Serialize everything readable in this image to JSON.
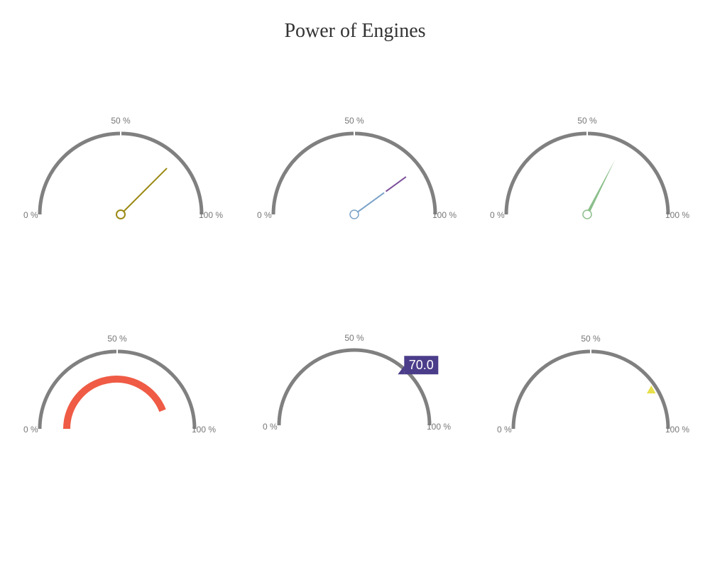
{
  "chart_data": {
    "type": "gauge",
    "title": "Power of Engines",
    "gauges": [
      {
        "min_label": "0 %",
        "mid_label": "50 %",
        "max_label": "100 %",
        "value": 75,
        "style": "needle",
        "needle_color": "#9a8a14"
      },
      {
        "min_label": "0 %",
        "mid_label": "50 %",
        "max_label": "100 %",
        "value": 80,
        "style": "needle-two-tone",
        "needle_color": "#7ba3c8",
        "tip_color": "#7b4f9a"
      },
      {
        "min_label": "0 %",
        "mid_label": "50 %",
        "max_label": "100 %",
        "value": 65,
        "style": "tapered-needle",
        "needle_color": "#8bbf8b"
      },
      {
        "min_label": "0 %",
        "mid_label": "50 %",
        "max_label": "100 %",
        "value": 88,
        "style": "arc",
        "bar_color": "#ef5b45"
      },
      {
        "min_label": "0 %",
        "mid_label": "50 %",
        "max_label": "100 %",
        "value": 70,
        "style": "value-label",
        "label_text": "70.0",
        "label_color": "#4b3d8a"
      },
      {
        "min_label": "0 %",
        "mid_label": "50 %",
        "max_label": "100 %",
        "value": 82,
        "style": "marker",
        "marker_color": "#e8e04a"
      }
    ]
  },
  "colors": {
    "scale": "#808080",
    "background": "#ffffff"
  }
}
